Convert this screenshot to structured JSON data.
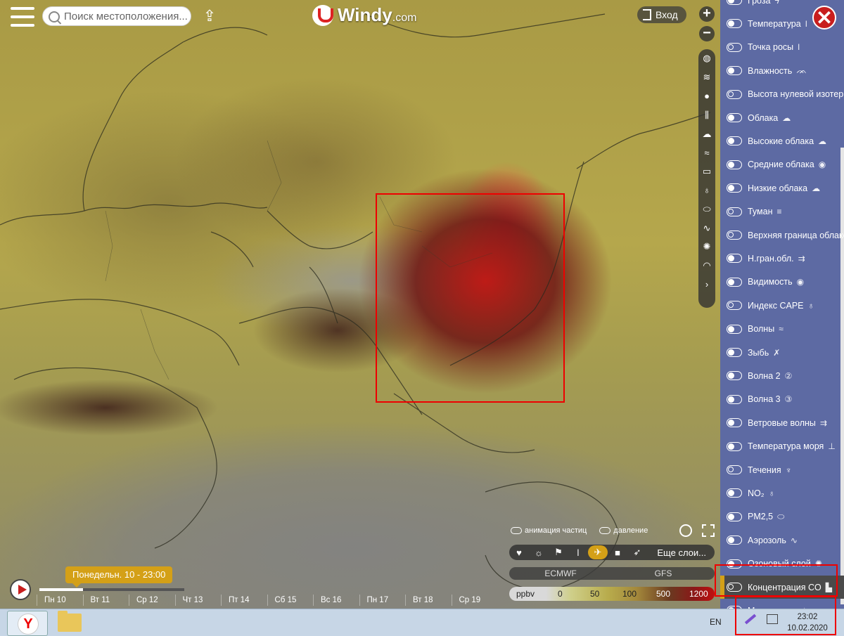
{
  "header": {
    "search_placeholder": "Поиск местоположения...",
    "logo_text": "Windy",
    "logo_domain": ".com",
    "login_label": "Вход",
    "zoom_in": "+",
    "zoom_out": "−"
  },
  "sidebar": {
    "items": [
      {
        "label": "Гроза",
        "on": true,
        "icon": "lightning-icon"
      },
      {
        "label": "Температура",
        "on": true,
        "icon": "thermometer-icon"
      },
      {
        "label": "Точка росы",
        "on": false,
        "icon": "dew-point-icon"
      },
      {
        "label": "Влажность",
        "on": true,
        "icon": "humidity-icon"
      },
      {
        "label": "Высота нулевой изотермы",
        "on": false,
        "icon": "isotherm-icon"
      },
      {
        "label": "Облака",
        "on": true,
        "icon": "cloud-icon"
      },
      {
        "label": "Высокие облака",
        "on": true,
        "icon": "high-cloud-icon"
      },
      {
        "label": "Средние облака",
        "on": true,
        "icon": "mid-cloud-icon"
      },
      {
        "label": "Низкие облака",
        "on": true,
        "icon": "low-cloud-icon"
      },
      {
        "label": "Туман",
        "on": false,
        "icon": "fog-icon"
      },
      {
        "label": "Верхняя граница облаков",
        "on": false,
        "icon": "cloud-top-icon"
      },
      {
        "label": "Н.гран.обл.",
        "on": true,
        "icon": "cloud-base-icon"
      },
      {
        "label": "Видимость",
        "on": true,
        "icon": "eye-icon"
      },
      {
        "label": "Индекс CAPE",
        "on": false,
        "icon": "cape-icon"
      },
      {
        "label": "Волны",
        "on": true,
        "icon": "waves-icon"
      },
      {
        "label": "Зыбь",
        "on": true,
        "icon": "swell-icon"
      },
      {
        "label": "Волна 2",
        "on": true,
        "icon": "number-2-icon"
      },
      {
        "label": "Волна 3",
        "on": true,
        "icon": "number-3-icon"
      },
      {
        "label": "Ветровые волны",
        "on": true,
        "icon": "wind-waves-icon"
      },
      {
        "label": "Температура моря",
        "on": true,
        "icon": "sea-temp-icon"
      },
      {
        "label": "Течения",
        "on": false,
        "icon": "currents-icon"
      },
      {
        "label": "NO₂",
        "on": true,
        "icon": "no2-icon"
      },
      {
        "label": "PM2,5",
        "on": true,
        "icon": "pm25-icon"
      },
      {
        "label": "Аэрозоль",
        "on": true,
        "icon": "aerosol-icon"
      },
      {
        "label": "Озоновый слой",
        "on": true,
        "icon": "ozone-icon"
      },
      {
        "label": "Концентрация CO",
        "on": false,
        "icon": "factory-icon",
        "active": true
      },
      {
        "label": "Места пыли",
        "on": true,
        "icon": "dust-icon"
      }
    ]
  },
  "layer_strip_icons": [
    "globe-icon",
    "wind-icon",
    "drop-icon",
    "thermometer-icon",
    "cloud-icon",
    "waves-icon",
    "car-icon",
    "bulb-icon",
    "canister-icon",
    "aerosol-icon",
    "sun-icon",
    "gauge-icon",
    "chevron-right-icon"
  ],
  "timeline": {
    "current": "Понедельн. 10 - 23:00",
    "progress": 0.3,
    "days": [
      "Пн 10",
      "Вт 11",
      "Ср 12",
      "Чт 13",
      "Пт 14",
      "Сб 15",
      "Вс 16",
      "Пн 17",
      "Вт 18",
      "Ср 19"
    ]
  },
  "options": {
    "particles": "анимация частиц",
    "pressure": "давление"
  },
  "toolbar": {
    "icons": [
      "heart-icon",
      "sun-cloud-icon",
      "flag-icon",
      "thermometer-icon",
      "plane-icon",
      "camera-icon",
      "windsock-icon"
    ],
    "more_layers": "Еще слои..."
  },
  "models": [
    "ECMWF",
    "GFS"
  ],
  "legend": {
    "unit": "ppbv",
    "ticks": [
      "0",
      "50",
      "100",
      "500",
      "1200"
    ]
  },
  "taskbar": {
    "lang": "EN",
    "time": "23:02",
    "date": "10.02.2020"
  },
  "colors": {
    "panel": "#5d6aa3",
    "accent": "#d4a017",
    "highlight": "#e00000"
  }
}
